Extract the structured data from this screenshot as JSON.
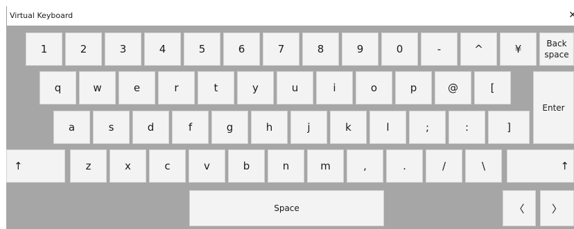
{
  "window": {
    "title": "Virtual Keyboard",
    "close_glyph": "✕"
  },
  "keys": {
    "row1": [
      "1",
      "2",
      "3",
      "4",
      "5",
      "6",
      "7",
      "8",
      "9",
      "0",
      "-",
      "^",
      "¥"
    ],
    "backspace": "Back\nspace",
    "row2": [
      "q",
      "w",
      "e",
      "r",
      "t",
      "y",
      "u",
      "i",
      "o",
      "p",
      "@",
      "["
    ],
    "enter": "Enter",
    "row3": [
      "a",
      "s",
      "d",
      "f",
      "g",
      "h",
      "j",
      "k",
      "l",
      ";",
      ":",
      "]"
    ],
    "shift_left": "↑",
    "row4": [
      "z",
      "x",
      "c",
      "v",
      "b",
      "n",
      "m",
      ",",
      ".",
      "/",
      "\\"
    ],
    "shift_right": "↑",
    "space": "Space",
    "arrow_left": "〈",
    "arrow_right": "〉"
  }
}
